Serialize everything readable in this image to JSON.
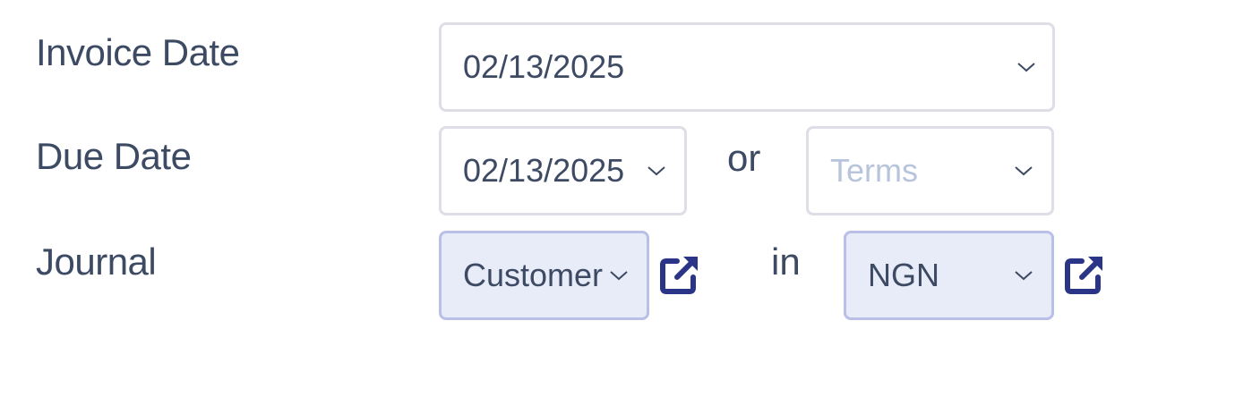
{
  "invoice_date": {
    "label": "Invoice Date",
    "value": "02/13/2025"
  },
  "due_date": {
    "label": "Due Date",
    "value": "02/13/2025",
    "or_text": "or",
    "terms_placeholder": "Terms"
  },
  "journal": {
    "label": "Journal",
    "value": "Customer",
    "in_text": "in",
    "currency_value": "NGN"
  },
  "icons": {
    "chevron": "chevron-down-icon",
    "external": "external-link-icon"
  },
  "colors": {
    "text": "#3d4a63",
    "placeholder": "#b8c3dc",
    "selected_bg": "#e8ebf8",
    "icon": "#2b3587"
  }
}
